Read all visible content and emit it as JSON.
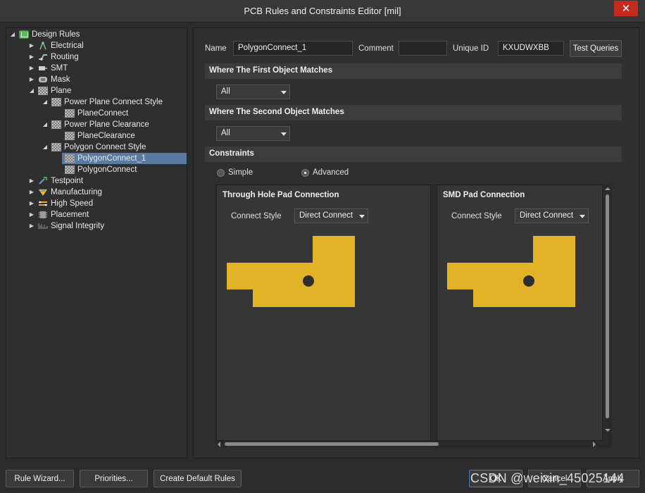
{
  "window": {
    "title": "PCB Rules and Constraints Editor [mil]",
    "close_label": "✕"
  },
  "tree": [
    {
      "label": "Design Rules",
      "arrow": "◢",
      "icon": "folder-rules-icon",
      "icon_color": "#5cb85c"
    },
    {
      "label": "Electrical",
      "arrow": "▶",
      "icon": "electrical-icon"
    },
    {
      "label": "Routing",
      "arrow": "▶",
      "icon": "routing-icon"
    },
    {
      "label": "SMT",
      "arrow": "▶",
      "icon": "smt-icon"
    },
    {
      "label": "Mask",
      "arrow": "▶",
      "icon": "mask-icon"
    },
    {
      "label": "Plane",
      "arrow": "◢",
      "icon": "plane-icon"
    },
    {
      "label": "Power Plane Connect Style",
      "arrow": "◢",
      "icon": "rule-grid-icon"
    },
    {
      "label": "PlaneConnect",
      "arrow": "",
      "icon": "rule-grid-icon"
    },
    {
      "label": "Power Plane Clearance",
      "arrow": "◢",
      "icon": "rule-grid-icon"
    },
    {
      "label": "PlaneClearance",
      "arrow": "",
      "icon": "rule-grid-icon"
    },
    {
      "label": "Polygon Connect Style",
      "arrow": "◢",
      "icon": "rule-grid-icon"
    },
    {
      "label": "PolygonConnect_1",
      "arrow": "",
      "icon": "rule-grid-icon",
      "selected": true
    },
    {
      "label": "PolygonConnect",
      "arrow": "",
      "icon": "rule-grid-icon"
    },
    {
      "label": "Testpoint",
      "arrow": "▶",
      "icon": "testpoint-icon"
    },
    {
      "label": "Manufacturing",
      "arrow": "▶",
      "icon": "manufacturing-icon"
    },
    {
      "label": "High Speed",
      "arrow": "▶",
      "icon": "high-speed-icon"
    },
    {
      "label": "Placement",
      "arrow": "▶",
      "icon": "placement-icon"
    },
    {
      "label": "Signal Integrity",
      "arrow": "▶",
      "icon": "signal-integrity-icon"
    }
  ],
  "form": {
    "name_label": "Name",
    "name_value": "PolygonConnect_1",
    "comment_label": "Comment",
    "comment_value": "",
    "uid_label": "Unique ID",
    "uid_value": "KXUDWXBB",
    "test_queries_label": "Test Queries"
  },
  "first_match": {
    "header": "Where The First Object Matches",
    "value": "All"
  },
  "second_match": {
    "header": "Where The Second Object Matches",
    "value": "All"
  },
  "constraints": {
    "header": "Constraints",
    "simple_label": "Simple",
    "advanced_label": "Advanced",
    "mode": "Advanced"
  },
  "through_hole": {
    "title": "Through Hole Pad Connection",
    "style_label": "Connect Style",
    "style_value": "Direct Connect"
  },
  "smd": {
    "title": "SMD Pad Connection",
    "style_label": "Connect Style",
    "style_value": "Direct Connect"
  },
  "colors": {
    "copper": "#e2b227",
    "pad_hole": "#2e2e2e",
    "selection": "#5a7ba0"
  },
  "buttons": {
    "rule_wizard": "Rule Wizard...",
    "priorities": "Priorities...",
    "create_default": "Create Default Rules",
    "ok": "OK",
    "cancel": "Cancel",
    "apply": "Apply"
  },
  "watermark": "CSDN @weixin_45025144"
}
